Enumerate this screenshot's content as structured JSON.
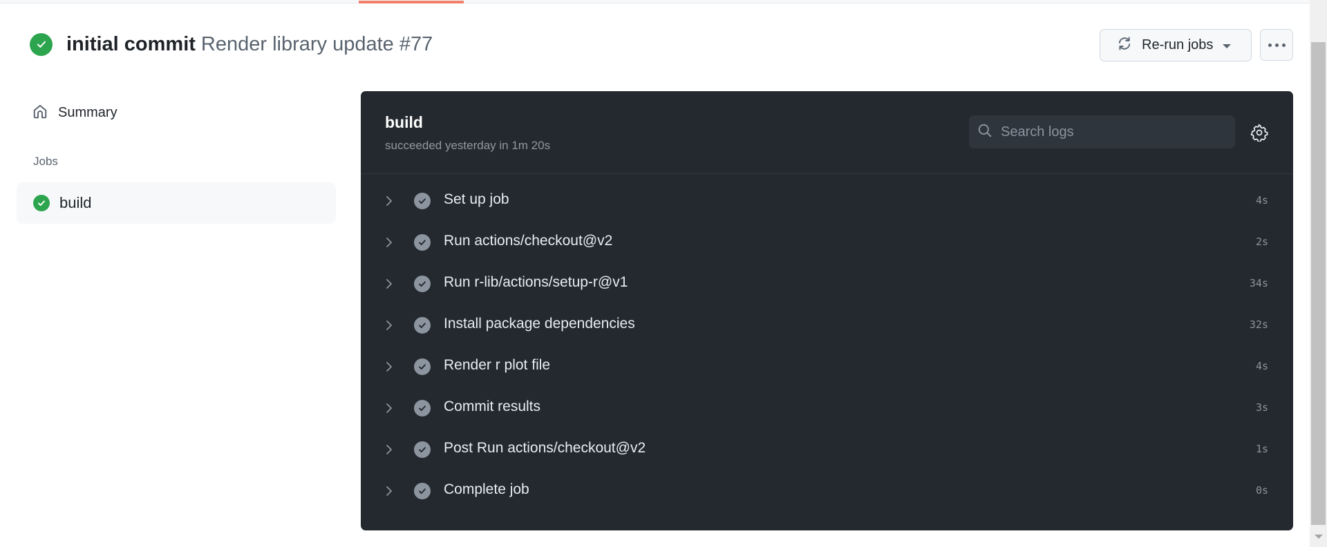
{
  "page": {
    "active_tab_indicator_color": "#f0806a"
  },
  "header": {
    "status": "success",
    "status_color": "#2da44e",
    "commit_title": "initial commit",
    "run_title": "Render library update #77",
    "rerun_label": "Re-run jobs",
    "more_label": "More options"
  },
  "sidebar": {
    "summary_label": "Summary",
    "jobs_heading": "Jobs",
    "jobs": [
      {
        "label": "build",
        "status": "success",
        "selected": true
      }
    ]
  },
  "job_panel": {
    "title": "build",
    "subtitle": "succeeded yesterday in 1m 20s",
    "search": {
      "placeholder": "Search logs",
      "value": ""
    },
    "steps": [
      {
        "name": "Set up job",
        "duration": "4s",
        "status": "success"
      },
      {
        "name": "Run actions/checkout@v2",
        "duration": "2s",
        "status": "success"
      },
      {
        "name": "Run r-lib/actions/setup-r@v1",
        "duration": "34s",
        "status": "success"
      },
      {
        "name": "Install package dependencies",
        "duration": "32s",
        "status": "success"
      },
      {
        "name": "Render r plot file",
        "duration": "4s",
        "status": "success"
      },
      {
        "name": "Commit results",
        "duration": "3s",
        "status": "success"
      },
      {
        "name": "Post Run actions/checkout@v2",
        "duration": "1s",
        "status": "success"
      },
      {
        "name": "Complete job",
        "duration": "0s",
        "status": "success"
      }
    ]
  }
}
